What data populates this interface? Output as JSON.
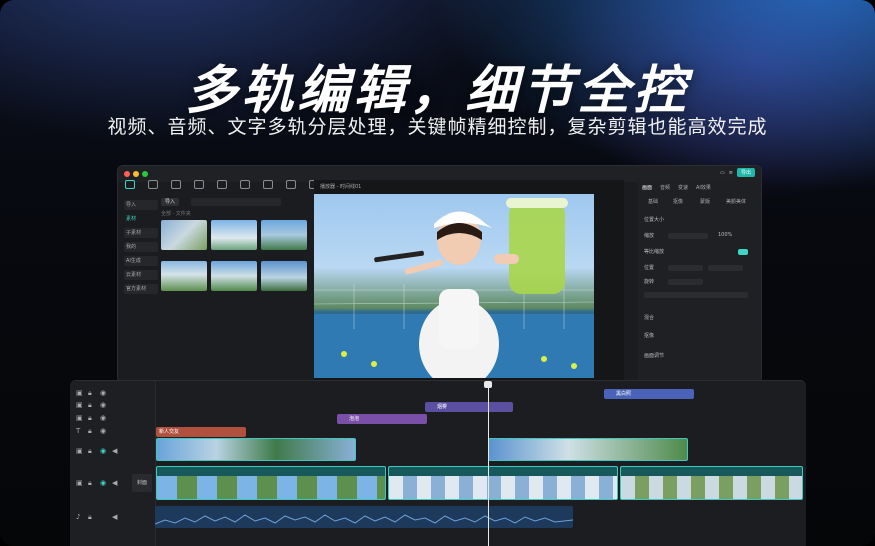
{
  "headline": {
    "title": "多轨编辑，细节全控",
    "subtitle": "视频、音频、文字多轨分层处理，关键帧精细控制，复杂剪辑也能高效完成"
  },
  "colors": {
    "accent": "#3dd6c6",
    "text_clip": "#b0513f",
    "sticker_clip": "#7a4fa8",
    "effect_clip": "#5a4fa0",
    "filter_clip": "#4a63b8",
    "audio": "#1d3a5c"
  },
  "toolbar": {
    "items": [
      {
        "icon": "media-icon"
      },
      {
        "icon": "audio-icon"
      },
      {
        "icon": "text-icon"
      },
      {
        "icon": "sticker-icon"
      },
      {
        "icon": "effects-icon"
      },
      {
        "icon": "transition-icon"
      },
      {
        "icon": "subtitle-icon"
      },
      {
        "icon": "filter-icon"
      },
      {
        "icon": "adjust-icon"
      },
      {
        "icon": "template-icon"
      }
    ],
    "export_label": "导出"
  },
  "left_nav": {
    "items": [
      "导入",
      "素材",
      "子素材",
      "我的",
      "AI生成",
      "云素材",
      "官方素材"
    ]
  },
  "media": {
    "import_label": "导入",
    "breadcrumb": "全部 · 文件夹"
  },
  "preview": {
    "header": "播放器 - 时间线01"
  },
  "properties": {
    "tabs": [
      "画面",
      "音频",
      "变速",
      "AI效果"
    ],
    "subtabs": [
      "基础",
      "抠像",
      "蒙版",
      "美颜美体"
    ],
    "rows": [
      "位置大小",
      "缩放",
      "等比缩放",
      "位置",
      "旋转",
      "混合",
      "抠像",
      "画面调节"
    ],
    "scale_value": "100%"
  },
  "timeline": {
    "cover_label": "封面",
    "clips": {
      "filter": "黑白照",
      "effect": "烟雾",
      "sticker": "泡泡",
      "text": "新人交友"
    }
  }
}
